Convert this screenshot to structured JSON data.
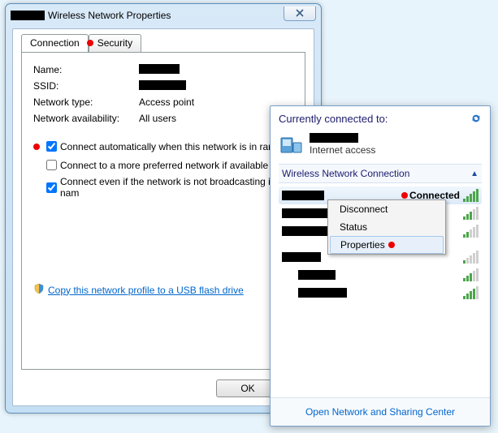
{
  "dialog": {
    "title": "Wireless Network Properties",
    "tabs": {
      "connection": "Connection",
      "security": "Security"
    },
    "fields": {
      "name_label": "Name:",
      "ssid_label": "SSID:",
      "nettype_label": "Network type:",
      "nettype_value": "Access point",
      "avail_label": "Network availability:",
      "avail_value": "All users"
    },
    "checks": {
      "auto": "Connect automatically when this network is in range",
      "auto_checked": true,
      "prefer": "Connect to a more preferred network if available",
      "prefer_checked": false,
      "hidden": "Connect even if the network is not broadcasting its nam",
      "hidden_checked": true
    },
    "copylink": "Copy this network profile to a USB flash drive",
    "buttons": {
      "ok": "OK"
    }
  },
  "flyout": {
    "title": "Currently connected to:",
    "subtext": "Internet access",
    "section": "Wireless Network Connection",
    "connected_status": "Connected",
    "menu": {
      "disconnect": "Disconnect",
      "status": "Status",
      "properties": "Properties"
    },
    "networks": [
      {
        "bars_on": 5
      },
      {
        "bars_on": 3
      },
      {
        "bars_on": 2
      },
      {
        "bars_on": 1
      },
      {
        "bars_on": 3
      },
      {
        "bars_on": 4
      }
    ],
    "footer": "Open Network and Sharing Center"
  }
}
